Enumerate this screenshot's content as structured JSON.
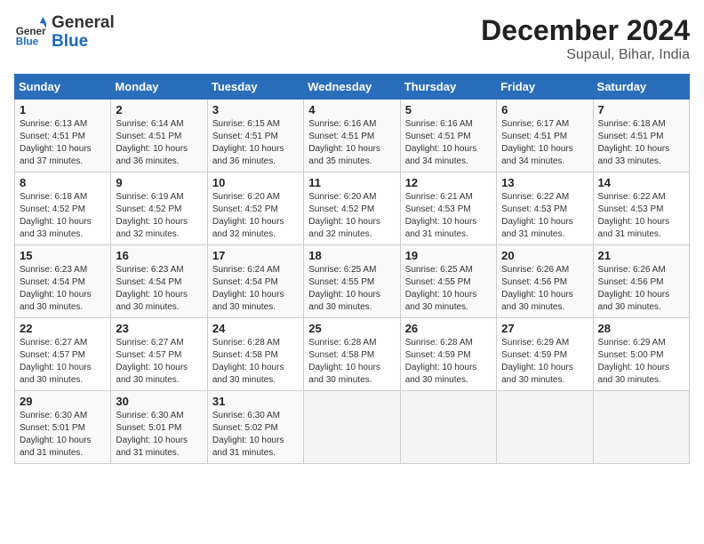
{
  "header": {
    "logo_general": "General",
    "logo_blue": "Blue",
    "month_title": "December 2024",
    "location": "Supaul, Bihar, India"
  },
  "weekdays": [
    "Sunday",
    "Monday",
    "Tuesday",
    "Wednesday",
    "Thursday",
    "Friday",
    "Saturday"
  ],
  "weeks": [
    [
      {
        "day": "1",
        "sunrise": "6:13 AM",
        "sunset": "4:51 PM",
        "daylight": "10 hours and 37 minutes."
      },
      {
        "day": "2",
        "sunrise": "6:14 AM",
        "sunset": "4:51 PM",
        "daylight": "10 hours and 36 minutes."
      },
      {
        "day": "3",
        "sunrise": "6:15 AM",
        "sunset": "4:51 PM",
        "daylight": "10 hours and 36 minutes."
      },
      {
        "day": "4",
        "sunrise": "6:16 AM",
        "sunset": "4:51 PM",
        "daylight": "10 hours and 35 minutes."
      },
      {
        "day": "5",
        "sunrise": "6:16 AM",
        "sunset": "4:51 PM",
        "daylight": "10 hours and 34 minutes."
      },
      {
        "day": "6",
        "sunrise": "6:17 AM",
        "sunset": "4:51 PM",
        "daylight": "10 hours and 34 minutes."
      },
      {
        "day": "7",
        "sunrise": "6:18 AM",
        "sunset": "4:51 PM",
        "daylight": "10 hours and 33 minutes."
      }
    ],
    [
      {
        "day": "8",
        "sunrise": "6:18 AM",
        "sunset": "4:52 PM",
        "daylight": "10 hours and 33 minutes."
      },
      {
        "day": "9",
        "sunrise": "6:19 AM",
        "sunset": "4:52 PM",
        "daylight": "10 hours and 32 minutes."
      },
      {
        "day": "10",
        "sunrise": "6:20 AM",
        "sunset": "4:52 PM",
        "daylight": "10 hours and 32 minutes."
      },
      {
        "day": "11",
        "sunrise": "6:20 AM",
        "sunset": "4:52 PM",
        "daylight": "10 hours and 32 minutes."
      },
      {
        "day": "12",
        "sunrise": "6:21 AM",
        "sunset": "4:53 PM",
        "daylight": "10 hours and 31 minutes."
      },
      {
        "day": "13",
        "sunrise": "6:22 AM",
        "sunset": "4:53 PM",
        "daylight": "10 hours and 31 minutes."
      },
      {
        "day": "14",
        "sunrise": "6:22 AM",
        "sunset": "4:53 PM",
        "daylight": "10 hours and 31 minutes."
      }
    ],
    [
      {
        "day": "15",
        "sunrise": "6:23 AM",
        "sunset": "4:54 PM",
        "daylight": "10 hours and 30 minutes."
      },
      {
        "day": "16",
        "sunrise": "6:23 AM",
        "sunset": "4:54 PM",
        "daylight": "10 hours and 30 minutes."
      },
      {
        "day": "17",
        "sunrise": "6:24 AM",
        "sunset": "4:54 PM",
        "daylight": "10 hours and 30 minutes."
      },
      {
        "day": "18",
        "sunrise": "6:25 AM",
        "sunset": "4:55 PM",
        "daylight": "10 hours and 30 minutes."
      },
      {
        "day": "19",
        "sunrise": "6:25 AM",
        "sunset": "4:55 PM",
        "daylight": "10 hours and 30 minutes."
      },
      {
        "day": "20",
        "sunrise": "6:26 AM",
        "sunset": "4:56 PM",
        "daylight": "10 hours and 30 minutes."
      },
      {
        "day": "21",
        "sunrise": "6:26 AM",
        "sunset": "4:56 PM",
        "daylight": "10 hours and 30 minutes."
      }
    ],
    [
      {
        "day": "22",
        "sunrise": "6:27 AM",
        "sunset": "4:57 PM",
        "daylight": "10 hours and 30 minutes."
      },
      {
        "day": "23",
        "sunrise": "6:27 AM",
        "sunset": "4:57 PM",
        "daylight": "10 hours and 30 minutes."
      },
      {
        "day": "24",
        "sunrise": "6:28 AM",
        "sunset": "4:58 PM",
        "daylight": "10 hours and 30 minutes."
      },
      {
        "day": "25",
        "sunrise": "6:28 AM",
        "sunset": "4:58 PM",
        "daylight": "10 hours and 30 minutes."
      },
      {
        "day": "26",
        "sunrise": "6:28 AM",
        "sunset": "4:59 PM",
        "daylight": "10 hours and 30 minutes."
      },
      {
        "day": "27",
        "sunrise": "6:29 AM",
        "sunset": "4:59 PM",
        "daylight": "10 hours and 30 minutes."
      },
      {
        "day": "28",
        "sunrise": "6:29 AM",
        "sunset": "5:00 PM",
        "daylight": "10 hours and 30 minutes."
      }
    ],
    [
      {
        "day": "29",
        "sunrise": "6:30 AM",
        "sunset": "5:01 PM",
        "daylight": "10 hours and 31 minutes."
      },
      {
        "day": "30",
        "sunrise": "6:30 AM",
        "sunset": "5:01 PM",
        "daylight": "10 hours and 31 minutes."
      },
      {
        "day": "31",
        "sunrise": "6:30 AM",
        "sunset": "5:02 PM",
        "daylight": "10 hours and 31 minutes."
      },
      null,
      null,
      null,
      null
    ]
  ]
}
